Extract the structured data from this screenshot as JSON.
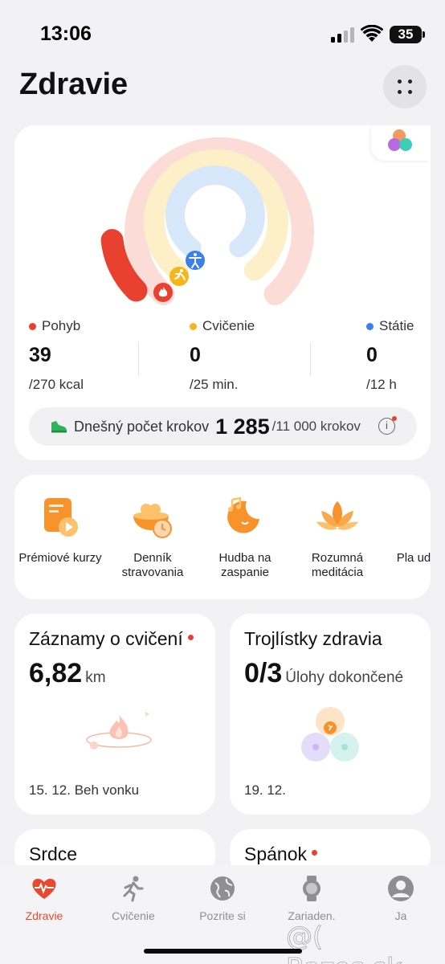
{
  "status_bar": {
    "time": "13:06",
    "battery": "35"
  },
  "header": {
    "title": "Zdravie"
  },
  "rings": {
    "move": {
      "label": "Pohyb",
      "value": "39",
      "goal": "/270 kcal",
      "color": "#e8412f",
      "progress": 0.144
    },
    "exercise": {
      "label": "Cvičenie",
      "value": "0",
      "goal": "/25 min.",
      "color": "#f6b51d",
      "progress": 0
    },
    "stand": {
      "label": "Státie",
      "value": "0",
      "goal": "/12 h",
      "color": "#3b7fe8",
      "progress": 0
    }
  },
  "steps": {
    "label": "Dnešný počet krokov",
    "value": "1 285",
    "goal": "/11 000 krokov",
    "info_icon": "i"
  },
  "services": [
    {
      "label": "Prémiové kurzy",
      "icon": "video-course-icon"
    },
    {
      "label": "Denník stravovania",
      "icon": "meal-diary-icon"
    },
    {
      "label": "Hudba na zaspanie",
      "icon": "sleep-music-icon"
    },
    {
      "label": "Rozumná meditácia",
      "icon": "lotus-icon"
    },
    {
      "label": "Pla udržiava",
      "icon": "plan-icon"
    }
  ],
  "tiles": {
    "exercise_records": {
      "title": "Záznamy o cvičení",
      "value": "6,82",
      "unit": "km",
      "footer": "15. 12. Beh vonku"
    },
    "health_clovers": {
      "title": "Trojlístky zdravia",
      "value": "0/3",
      "unit": "Úlohy dokončené",
      "footer": "19. 12."
    },
    "heart": {
      "title": "Srdce"
    },
    "sleep": {
      "title": "Spánok"
    }
  },
  "tabbar": [
    {
      "label": "Zdravie",
      "icon": "heart-pulse-icon",
      "active": true
    },
    {
      "label": "Cvičenie",
      "icon": "running-icon",
      "active": false
    },
    {
      "label": "Pozrite si",
      "icon": "globe-icon",
      "active": false
    },
    {
      "label": "Zariaden.",
      "icon": "watch-icon",
      "active": false
    },
    {
      "label": "Ja",
      "icon": "profile-icon",
      "active": false
    }
  ],
  "watermark": "@( Bazos.sk",
  "colors": {
    "accent": "#e7492f",
    "move_track": "#fbdcd6",
    "exercise_track": "#fdefc8",
    "stand_track": "#d7e8fb"
  }
}
